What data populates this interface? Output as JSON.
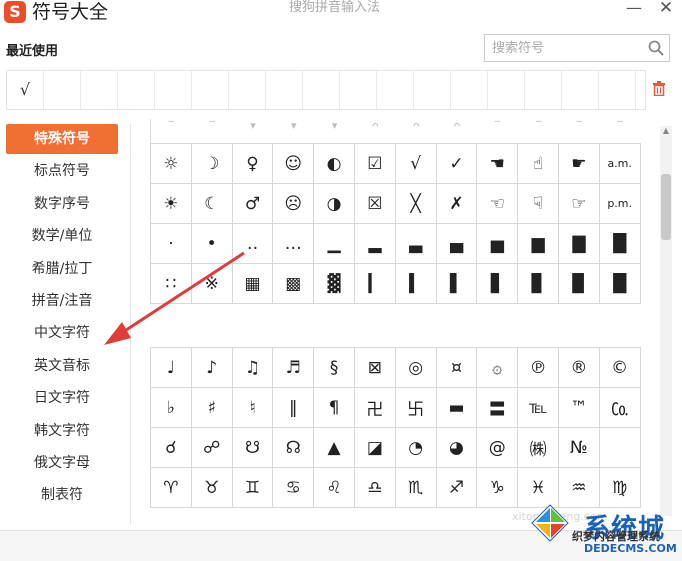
{
  "window": {
    "logo_text": "S",
    "title": "符号大全",
    "subtitle": "搜狗拼音输入法",
    "minimize": "—",
    "close": "✕"
  },
  "recent": {
    "label": "最近使用",
    "items": [
      "√",
      "",
      "",
      "",
      "",
      "",
      "",
      "",
      "",
      "",
      "",
      "",
      "",
      "",
      "",
      "",
      ""
    ]
  },
  "search": {
    "placeholder": "搜索符号"
  },
  "sidebar": {
    "items": [
      {
        "label": "特殊符号",
        "active": true
      },
      {
        "label": "标点符号"
      },
      {
        "label": "数字序号"
      },
      {
        "label": "数学/单位"
      },
      {
        "label": "希腊/拉丁"
      },
      {
        "label": "拼音/注音"
      },
      {
        "label": "中文字符"
      },
      {
        "label": "英文音标"
      },
      {
        "label": "日文字符"
      },
      {
        "label": "韩文字符"
      },
      {
        "label": "俄文字母"
      },
      {
        "label": "制表符"
      }
    ]
  },
  "grid1": {
    "cells": [
      "☼",
      "☽",
      "♀",
      "☺",
      "◐",
      "☑",
      "√",
      "✓",
      "☚",
      "☝",
      "☛",
      "a.m.",
      "☀",
      "☾",
      "♂",
      "☹",
      "◑",
      "☒",
      "╳",
      "✗",
      "☜",
      "☟",
      "☞",
      "p.m.",
      "·",
      "•",
      "‥",
      "…",
      "▁",
      "▂",
      "▃",
      "▄",
      "▅",
      "▆",
      "▇",
      "█",
      "∷",
      "※",
      "▦",
      "▩",
      "▓",
      "▎",
      "▍",
      "▌",
      "▋",
      "▊",
      "▉",
      "█"
    ]
  },
  "grid2": {
    "cells": [
      "♩",
      "♪",
      "♫",
      "♬",
      "§",
      "⊠",
      "◎",
      "¤",
      "۞",
      "℗",
      "®",
      "©",
      "♭",
      "♯",
      "♮",
      "‖",
      "¶",
      "卍",
      "卐",
      "▬",
      "〓",
      "℡",
      "™",
      "㏇",
      "☌",
      "☍",
      "☋",
      "☊",
      "▲",
      "◪",
      "◔",
      "◕",
      "@",
      "㈱",
      "№",
      "",
      "♈",
      "♉",
      "♊",
      "♋",
      "♌",
      "♎",
      "♏",
      "♐",
      "♑",
      "♓",
      "♒",
      "♍"
    ]
  },
  "scrollbar": {
    "up_arrow": "▲"
  },
  "watermark": {
    "brand": "系统城",
    "cn": "织梦内容管理系统",
    "url": "DEDECMS.COM",
    "site": "xitongcheng.com"
  }
}
